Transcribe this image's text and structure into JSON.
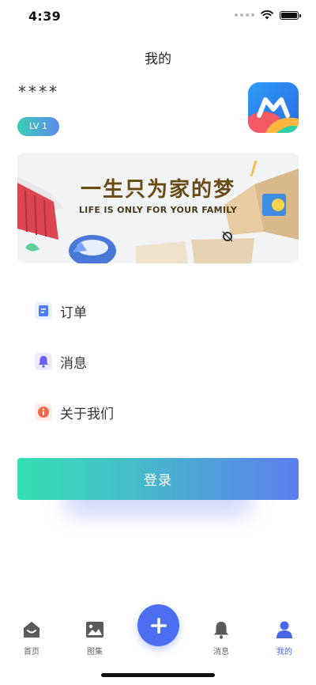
{
  "status_bar": {
    "time": "4:39"
  },
  "header": {
    "title": "我的"
  },
  "profile": {
    "username": "****",
    "level": "LV 1"
  },
  "banner": {
    "title_cn": "一生只为家的梦",
    "title_en": "LIFE IS ONLY FOR YOUR FAMILY"
  },
  "menu": {
    "items": [
      {
        "label": "订单",
        "icon": "order-icon",
        "color": "#4f7df0"
      },
      {
        "label": "消息",
        "icon": "bell-icon",
        "color": "#6a5cf0"
      },
      {
        "label": "关于我们",
        "icon": "info-icon",
        "color": "#f06a4a"
      }
    ]
  },
  "login": {
    "label": "登录"
  },
  "tabbar": {
    "items": [
      {
        "label": "首页",
        "icon": "home-icon",
        "active": false
      },
      {
        "label": "图集",
        "icon": "gallery-icon",
        "active": false
      },
      {
        "label": "",
        "icon": "plus-icon",
        "active": false
      },
      {
        "label": "消息",
        "icon": "bell-icon",
        "active": false
      },
      {
        "label": "我的",
        "icon": "user-icon",
        "active": true
      }
    ]
  },
  "colors": {
    "accent": "#4b6ff0",
    "gradient_start": "#34e0b3",
    "gradient_end": "#5d7df0"
  }
}
